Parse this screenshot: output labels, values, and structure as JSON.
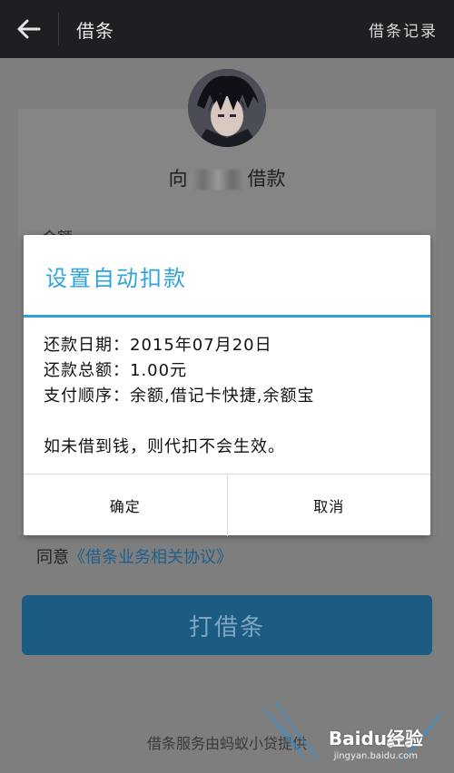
{
  "header": {
    "title": "借条",
    "records_label": "借条记录"
  },
  "form": {
    "borrow_prefix": "向",
    "borrow_suffix": "借款",
    "amount_label": "金额",
    "agree_prefix": "同意",
    "agree_link": "《借条业务相关协议》",
    "submit_label": "打借条",
    "footer": "借条服务由蚂蚁小贷提供"
  },
  "dialog": {
    "title": "设置自动扣款",
    "date_line": "还款日期：2015年07月20日",
    "amount_line": "还款总额：1.00元",
    "order_line": "支付顺序：余额,借记卡快捷,余额宝",
    "note": "如未借到钱，则代扣不会生效。",
    "confirm_label": "确定",
    "cancel_label": "取消"
  },
  "watermark": {
    "brand": "Baidu经验",
    "url": "jingyan.baidu.com"
  },
  "colors": {
    "accent": "#2fa3d8",
    "topbar": "#1d1f22",
    "button": "#1c5b82"
  },
  "icons": {
    "back": "arrow-left-icon"
  }
}
